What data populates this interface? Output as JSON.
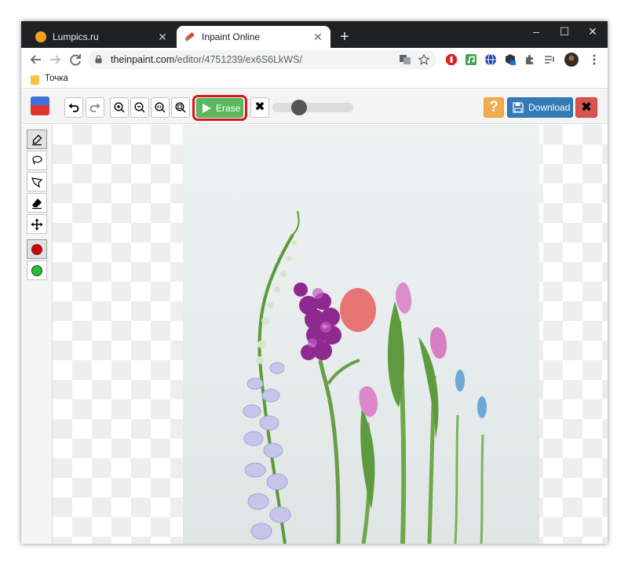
{
  "browser": {
    "tabs": [
      {
        "title": "Lumpics.ru",
        "active": false,
        "close": "✕"
      },
      {
        "title": "Inpaint Online",
        "active": true,
        "close": "✕"
      }
    ],
    "new_tab": "+",
    "window_controls": {
      "minimize": "–",
      "maximize": "☐",
      "close": "✕"
    },
    "address": {
      "host": "theinpaint.com",
      "path": "/editor/4751239/ex6S6LkWS/"
    },
    "bookmarks": [
      {
        "label": "Точка"
      }
    ],
    "accent_color": "#202124"
  },
  "app": {
    "name": "Inpaint Online",
    "toolbar": {
      "erase_label": "Erase",
      "cancel_glyph": "✖",
      "help_glyph": "?",
      "download_label": "Download",
      "close_glyph": "✖",
      "brush_size_fraction": 0.33
    },
    "tools": [
      {
        "name": "marker",
        "selected": true
      },
      {
        "name": "lasso",
        "selected": false
      },
      {
        "name": "polygon-lasso",
        "selected": false
      },
      {
        "name": "eraser",
        "selected": false
      },
      {
        "name": "move",
        "selected": false
      }
    ],
    "colors": [
      {
        "name": "red",
        "hex": "#dd0000",
        "selected": true
      },
      {
        "name": "green",
        "hex": "#22c22e",
        "selected": false
      }
    ],
    "colors_ui": {
      "erase": "#5cb85c",
      "download": "#337ab7",
      "help": "#f0ad4e",
      "close": "#d9534f",
      "highlight": "#d8161c"
    }
  }
}
